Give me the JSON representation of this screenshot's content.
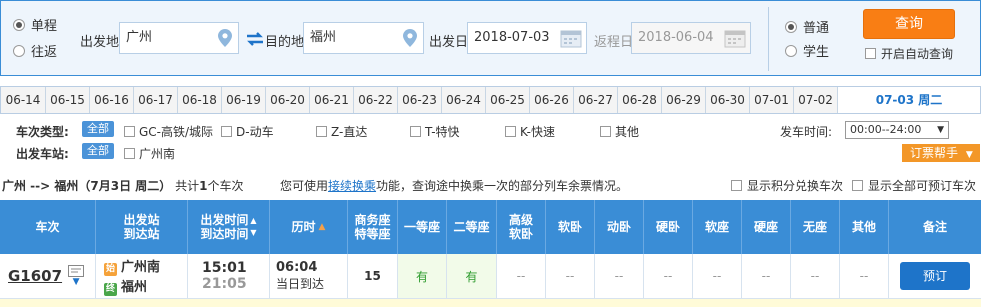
{
  "search": {
    "trip_types": [
      {
        "label": "单程",
        "selected": true
      },
      {
        "label": "往返",
        "selected": false
      }
    ],
    "from_label": "出发地",
    "from_value": "广州",
    "to_label": "目的地",
    "to_value": "福州",
    "depart_label": "出发日",
    "depart_value": "2018-07-03",
    "return_label": "返程日",
    "return_value": "2018-06-04",
    "passenger_types": [
      {
        "label": "普通",
        "selected": true
      },
      {
        "label": "学生",
        "selected": false
      }
    ],
    "query_label": "查询",
    "auto_query_label": "开启自动查询"
  },
  "dates": {
    "tabs": [
      "06-14",
      "06-15",
      "06-16",
      "06-17",
      "06-18",
      "06-19",
      "06-20",
      "06-21",
      "06-22",
      "06-23",
      "06-24",
      "06-25",
      "06-26",
      "06-27",
      "06-28",
      "06-29",
      "06-30",
      "07-01",
      "07-02"
    ],
    "active": "07-03 周二"
  },
  "filters": {
    "train_type_title": "车次类型:",
    "all_label": "全部",
    "train_types": [
      "GC-高铁/城际",
      "D-动车",
      "Z-直达",
      "T-特快",
      "K-快速",
      "其他"
    ],
    "station_title": "出发车站:",
    "stations": [
      "广州南"
    ],
    "time_title": "发车时间:",
    "time_value": "00:00--24:00",
    "helper_label": "订票帮手"
  },
  "summary": {
    "route": "广州 --> 福州（7月3日  周二）",
    "count_prefix": "共计",
    "count": "1",
    "count_suffix": "个车次",
    "tip_prefix": "您可使用",
    "tip_link": "接续换乘",
    "tip_suffix": "功能，查询途中换乘一次的部分列车余票情况。",
    "option_points": "显示积分兑换车次",
    "option_all": "显示全部可预订车次"
  },
  "table": {
    "headers": {
      "train": "车次",
      "stations_1": "出发站",
      "stations_2": "到达站",
      "time_1": "出发时间",
      "time_2": "到达时间",
      "duration": "历时",
      "business_1": "商务座",
      "business_2": "特等座",
      "first": "一等座",
      "second": "二等座",
      "premium_1": "高级",
      "premium_2": "软卧",
      "soft_sleeper": "软卧",
      "bullet_sleeper": "动卧",
      "hard_sleeper": "硬卧",
      "soft_seat": "软座",
      "hard_seat": "硬座",
      "no_seat": "无座",
      "other": "其他",
      "remark": "备注"
    },
    "row": {
      "train_no": "G1607",
      "from_tag": "始",
      "from_station": "广州南",
      "to_tag": "终",
      "to_station": "福州",
      "depart_time": "15:01",
      "arrive_time": "21:05",
      "duration": "06:04",
      "arrive_day": "当日到达",
      "business": "15",
      "first": "有",
      "second": "有",
      "premium": "--",
      "soft_sleeper": "--",
      "bullet_sleeper": "--",
      "hard_sleeper": "--",
      "soft_seat": "--",
      "hard_seat": "--",
      "no_seat": "--",
      "other": "--",
      "book_label": "预订"
    }
  },
  "colors": {
    "accent": "#3a8dd6",
    "query": "#f97e14",
    "available": "#2d9b2d"
  }
}
